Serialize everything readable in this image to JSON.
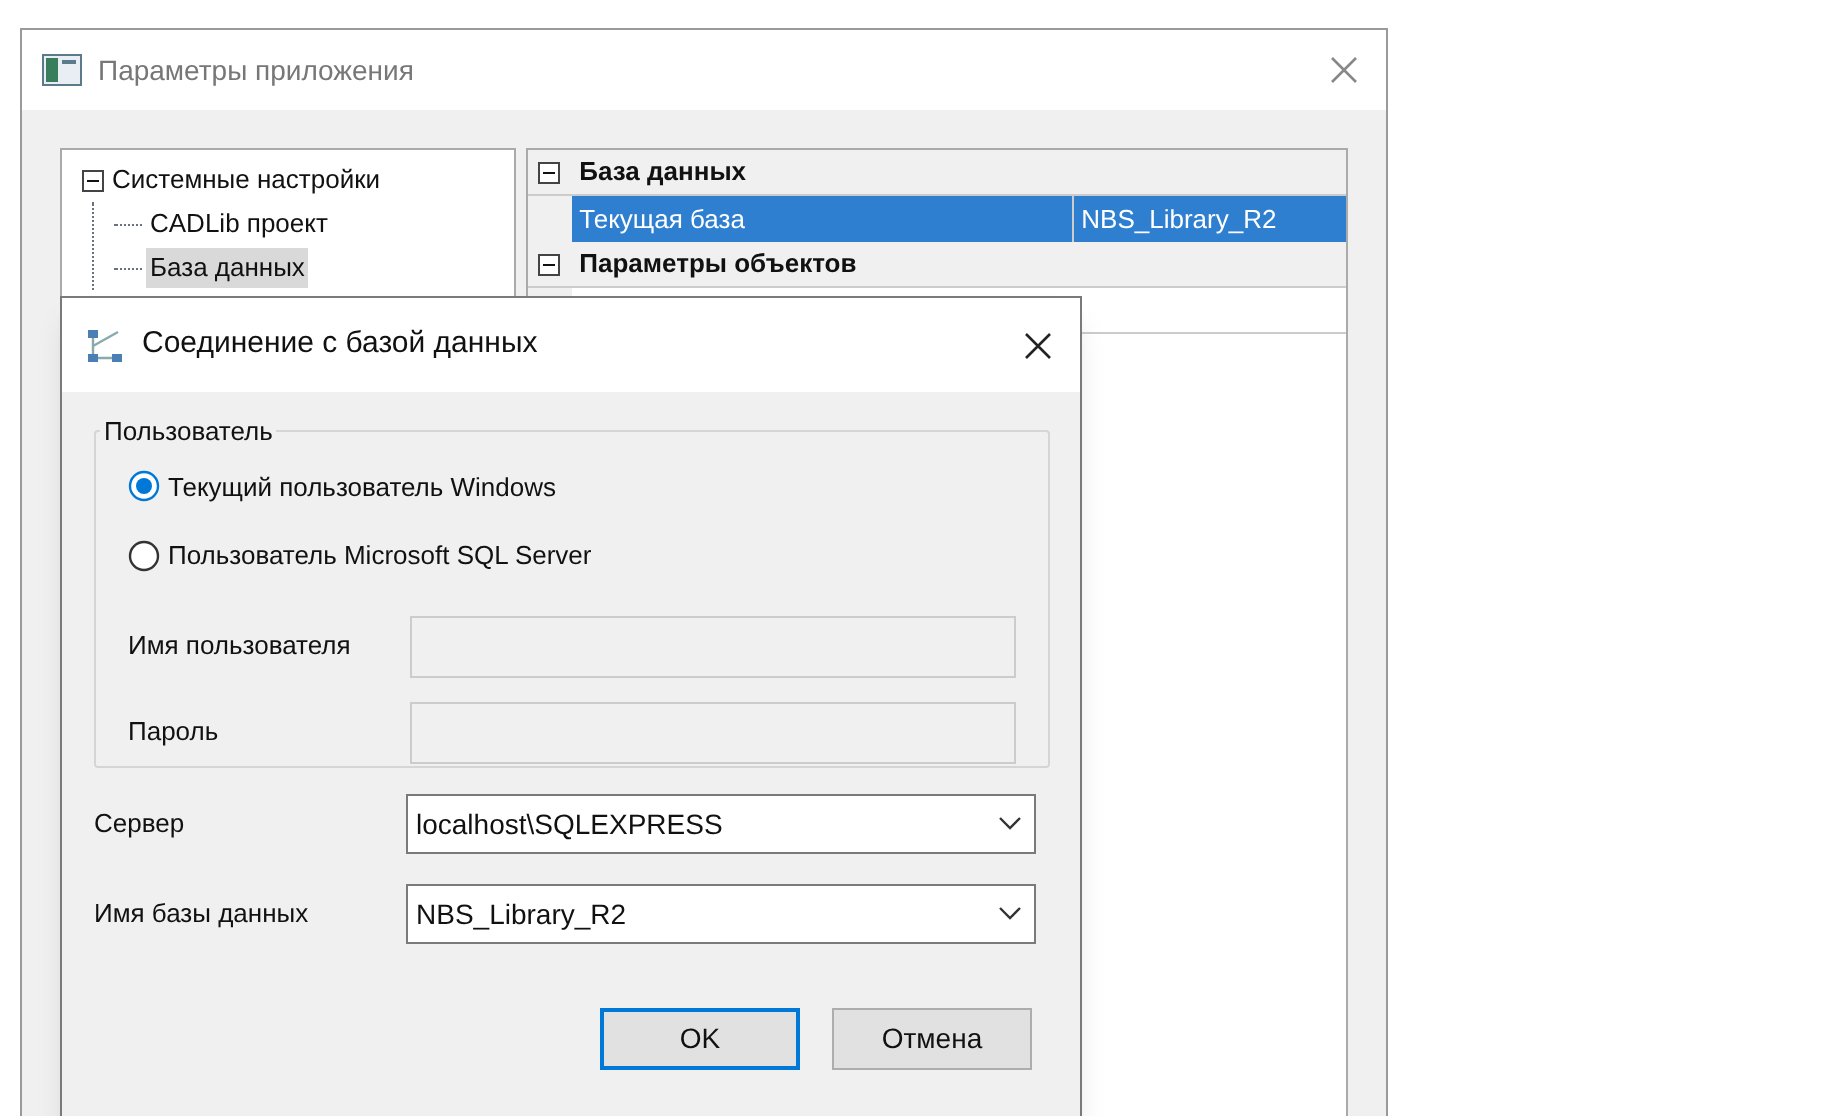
{
  "app_window": {
    "title": "Параметры приложения"
  },
  "tree": [
    {
      "label": "Системные настройки",
      "expanded": true,
      "selected": false,
      "children": [
        {
          "label": "CADLib проект",
          "selected": false
        },
        {
          "label": "База данных",
          "selected": true
        }
      ]
    }
  ],
  "property_grid": {
    "categories": [
      {
        "title": "База данных",
        "expanded": true,
        "rows": [
          {
            "name": "Текущая база",
            "value": "NBS_Library_R2",
            "selected": true
          }
        ]
      },
      {
        "title": "Параметры объектов",
        "expanded": true
      }
    ]
  },
  "dialog": {
    "title": "Соединение с базой данных",
    "user_group": {
      "legend": "Пользователь",
      "options": [
        {
          "label": "Текущий пользователь Windows",
          "selected": true
        },
        {
          "label": "Пользователь Microsoft SQL Server",
          "selected": false
        }
      ],
      "fields": [
        {
          "label": "Имя пользователя",
          "disabled": true
        },
        {
          "label": "Пароль",
          "disabled": true
        }
      ]
    },
    "combos": [
      {
        "label": "Сервер",
        "value": "localhost\\SQLEXPRESS"
      },
      {
        "label": "Имя базы данных",
        "value": "NBS_Library_R2"
      }
    ],
    "buttons": [
      {
        "label": "OK",
        "default": true
      },
      {
        "label": "Отмена",
        "default": false
      }
    ]
  }
}
